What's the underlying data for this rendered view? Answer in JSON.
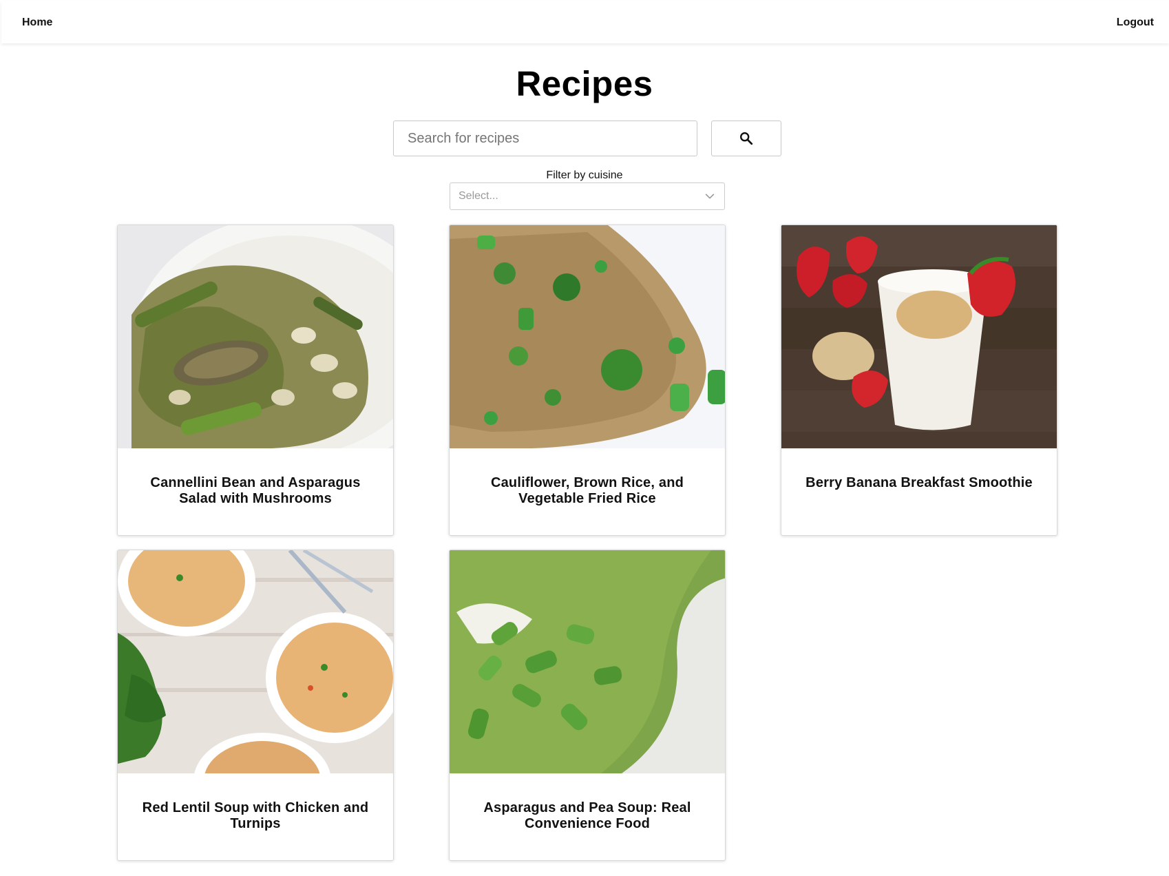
{
  "nav": {
    "home_label": "Home",
    "logout_label": "Logout"
  },
  "page": {
    "title": "Recipes"
  },
  "search": {
    "placeholder": "Search for recipes",
    "value": "",
    "button_icon": "search-icon"
  },
  "filter": {
    "label": "Filter by cuisine",
    "placeholder": "Select...",
    "icon": "chevron-down-icon"
  },
  "recipes": [
    {
      "title": "Cannellini Bean and Asparagus Salad with Mushrooms",
      "image": "bean-asparagus-salad-photo"
    },
    {
      "title": "Cauliflower, Brown Rice, and Vegetable Fried Rice",
      "image": "fried-rice-photo"
    },
    {
      "title": "Berry Banana Breakfast Smoothie",
      "image": "smoothie-photo"
    },
    {
      "title": "Red Lentil Soup with Chicken and Turnips",
      "image": "lentil-soup-photo"
    },
    {
      "title": "Asparagus and Pea Soup: Real Convenience Food",
      "image": "pea-soup-photo"
    }
  ]
}
